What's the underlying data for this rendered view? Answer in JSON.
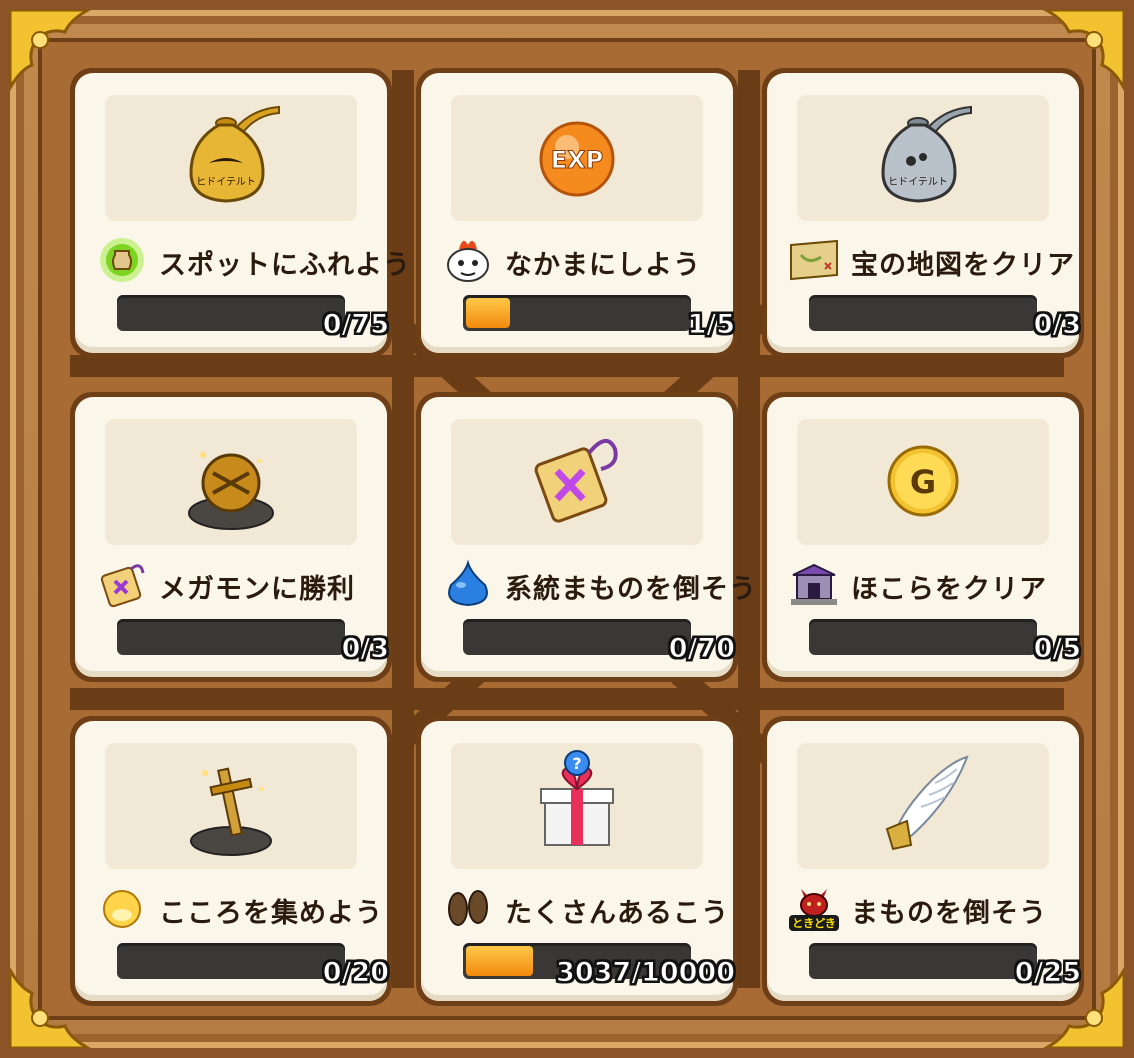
{
  "missions": [
    {
      "item_icon": "gold-pot-icon",
      "small_icon": "green-jar-icon",
      "label": "スポットにふれよう",
      "progress_text": "0/75",
      "progress": 0.0
    },
    {
      "item_icon": "exp-orb-icon",
      "small_icon": "monster-face-icon",
      "label": "なかまにしよう",
      "progress_text": "1/5",
      "progress": 0.2
    },
    {
      "item_icon": "silver-pot-icon",
      "small_icon": "treasure-map-icon",
      "label": "宝の地図をクリア",
      "progress_text": "0/3",
      "progress": 0.0
    },
    {
      "item_icon": "gold-orb-on-rock-icon",
      "small_icon": "purple-talisman-icon",
      "label": "メガモンに勝利",
      "progress_text": "0/3",
      "progress": 0.0
    },
    {
      "item_icon": "purple-talisman-icon",
      "small_icon": "blue-slime-icon",
      "label": "系統まものを倒そう",
      "progress_text": "0/70",
      "progress": 0.0
    },
    {
      "item_icon": "gold-coin-icon",
      "small_icon": "shrine-icon",
      "label": "ほこらをクリア",
      "progress_text": "0/5",
      "progress": 0.0
    },
    {
      "item_icon": "sword-in-rock-icon",
      "small_icon": "yellow-heart-orb-icon",
      "label": "こころを集めよう",
      "progress_text": "0/20",
      "progress": 0.0
    },
    {
      "item_icon": "mystery-gift-icon",
      "small_icon": "footprints-icon",
      "label": "たくさんあるこう",
      "progress_text": "3037/10000",
      "progress": 0.3037
    },
    {
      "item_icon": "angel-wing-icon",
      "small_icon": "tokidoki-demon-icon",
      "label": "まものを倒そう",
      "progress_text": "0/25",
      "progress": 0.0
    }
  ],
  "icon_text": {
    "exp": "EXP",
    "coin": "G",
    "tokidoki": "ときどき"
  },
  "colors": {
    "frame_wood": "#b47b42",
    "card_bg": "#fbf6ea",
    "bar_bg": "#3a3836",
    "bar_fill": "#f28a0c"
  }
}
